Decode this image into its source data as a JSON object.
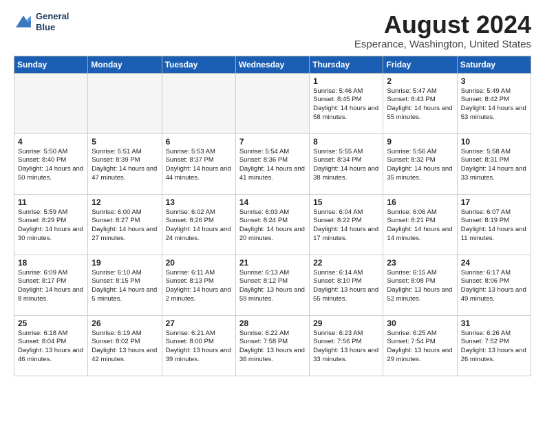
{
  "logo": {
    "line1": "General",
    "line2": "Blue"
  },
  "title": "August 2024",
  "subtitle": "Esperance, Washington, United States",
  "weekdays": [
    "Sunday",
    "Monday",
    "Tuesday",
    "Wednesday",
    "Thursday",
    "Friday",
    "Saturday"
  ],
  "weeks": [
    [
      {
        "day": "",
        "info": ""
      },
      {
        "day": "",
        "info": ""
      },
      {
        "day": "",
        "info": ""
      },
      {
        "day": "",
        "info": ""
      },
      {
        "day": "1",
        "info": "Sunrise: 5:46 AM\nSunset: 8:45 PM\nDaylight: 14 hours\nand 58 minutes."
      },
      {
        "day": "2",
        "info": "Sunrise: 5:47 AM\nSunset: 8:43 PM\nDaylight: 14 hours\nand 55 minutes."
      },
      {
        "day": "3",
        "info": "Sunrise: 5:49 AM\nSunset: 8:42 PM\nDaylight: 14 hours\nand 53 minutes."
      }
    ],
    [
      {
        "day": "4",
        "info": "Sunrise: 5:50 AM\nSunset: 8:40 PM\nDaylight: 14 hours\nand 50 minutes."
      },
      {
        "day": "5",
        "info": "Sunrise: 5:51 AM\nSunset: 8:39 PM\nDaylight: 14 hours\nand 47 minutes."
      },
      {
        "day": "6",
        "info": "Sunrise: 5:53 AM\nSunset: 8:37 PM\nDaylight: 14 hours\nand 44 minutes."
      },
      {
        "day": "7",
        "info": "Sunrise: 5:54 AM\nSunset: 8:36 PM\nDaylight: 14 hours\nand 41 minutes."
      },
      {
        "day": "8",
        "info": "Sunrise: 5:55 AM\nSunset: 8:34 PM\nDaylight: 14 hours\nand 38 minutes."
      },
      {
        "day": "9",
        "info": "Sunrise: 5:56 AM\nSunset: 8:32 PM\nDaylight: 14 hours\nand 35 minutes."
      },
      {
        "day": "10",
        "info": "Sunrise: 5:58 AM\nSunset: 8:31 PM\nDaylight: 14 hours\nand 33 minutes."
      }
    ],
    [
      {
        "day": "11",
        "info": "Sunrise: 5:59 AM\nSunset: 8:29 PM\nDaylight: 14 hours\nand 30 minutes."
      },
      {
        "day": "12",
        "info": "Sunrise: 6:00 AM\nSunset: 8:27 PM\nDaylight: 14 hours\nand 27 minutes."
      },
      {
        "day": "13",
        "info": "Sunrise: 6:02 AM\nSunset: 8:26 PM\nDaylight: 14 hours\nand 24 minutes."
      },
      {
        "day": "14",
        "info": "Sunrise: 6:03 AM\nSunset: 8:24 PM\nDaylight: 14 hours\nand 20 minutes."
      },
      {
        "day": "15",
        "info": "Sunrise: 6:04 AM\nSunset: 8:22 PM\nDaylight: 14 hours\nand 17 minutes."
      },
      {
        "day": "16",
        "info": "Sunrise: 6:06 AM\nSunset: 8:21 PM\nDaylight: 14 hours\nand 14 minutes."
      },
      {
        "day": "17",
        "info": "Sunrise: 6:07 AM\nSunset: 8:19 PM\nDaylight: 14 hours\nand 11 minutes."
      }
    ],
    [
      {
        "day": "18",
        "info": "Sunrise: 6:09 AM\nSunset: 8:17 PM\nDaylight: 14 hours\nand 8 minutes."
      },
      {
        "day": "19",
        "info": "Sunrise: 6:10 AM\nSunset: 8:15 PM\nDaylight: 14 hours\nand 5 minutes."
      },
      {
        "day": "20",
        "info": "Sunrise: 6:11 AM\nSunset: 8:13 PM\nDaylight: 14 hours\nand 2 minutes."
      },
      {
        "day": "21",
        "info": "Sunrise: 6:13 AM\nSunset: 8:12 PM\nDaylight: 13 hours\nand 59 minutes."
      },
      {
        "day": "22",
        "info": "Sunrise: 6:14 AM\nSunset: 8:10 PM\nDaylight: 13 hours\nand 55 minutes."
      },
      {
        "day": "23",
        "info": "Sunrise: 6:15 AM\nSunset: 8:08 PM\nDaylight: 13 hours\nand 52 minutes."
      },
      {
        "day": "24",
        "info": "Sunrise: 6:17 AM\nSunset: 8:06 PM\nDaylight: 13 hours\nand 49 minutes."
      }
    ],
    [
      {
        "day": "25",
        "info": "Sunrise: 6:18 AM\nSunset: 8:04 PM\nDaylight: 13 hours\nand 46 minutes."
      },
      {
        "day": "26",
        "info": "Sunrise: 6:19 AM\nSunset: 8:02 PM\nDaylight: 13 hours\nand 42 minutes."
      },
      {
        "day": "27",
        "info": "Sunrise: 6:21 AM\nSunset: 8:00 PM\nDaylight: 13 hours\nand 39 minutes."
      },
      {
        "day": "28",
        "info": "Sunrise: 6:22 AM\nSunset: 7:58 PM\nDaylight: 13 hours\nand 36 minutes."
      },
      {
        "day": "29",
        "info": "Sunrise: 6:23 AM\nSunset: 7:56 PM\nDaylight: 13 hours\nand 33 minutes."
      },
      {
        "day": "30",
        "info": "Sunrise: 6:25 AM\nSunset: 7:54 PM\nDaylight: 13 hours\nand 29 minutes."
      },
      {
        "day": "31",
        "info": "Sunrise: 6:26 AM\nSunset: 7:52 PM\nDaylight: 13 hours\nand 26 minutes."
      }
    ]
  ]
}
